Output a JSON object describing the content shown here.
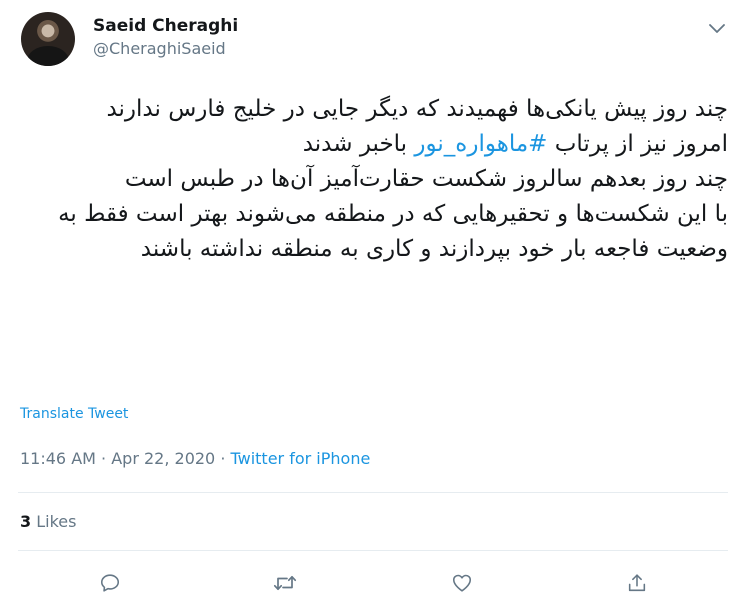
{
  "author": {
    "display_name": "Saeid Cheraghi",
    "handle": "@CheraghiSaeid"
  },
  "tweet": {
    "line1": "چند روز پیش یانکی‌ها فهمیدند که دیگر جایی در خلیج فارس ندارند",
    "line2_before": "امروز نیز از پرتاب ",
    "line2_hashtag": "#ماهواره_نور",
    "line2_after": " باخبر شدند",
    "line3": "چند روز بعدهم سالروز شکست حقارت‌آمیز آن‌ها در طبس است",
    "line4": "با این شکست‌ها و تحقیرهایی که در منطقه می‌شوند بهتر است فقط به وضعیت فاجعه بار خود بپردازند و کاری به منطقه نداشته باشند"
  },
  "translate_label": "Translate Tweet",
  "meta": {
    "time": "11:46 AM",
    "separator": " · ",
    "date": "Apr 22, 2020",
    "source": "Twitter for iPhone"
  },
  "stats": {
    "likes_count": "3",
    "likes_label": "Likes"
  },
  "colors": {
    "link": "#1b95e0",
    "muted": "#657786",
    "text": "#14171a",
    "divider": "#e6ecf0"
  },
  "icons": {
    "menu": "chevron-down-icon",
    "reply": "reply-icon",
    "retweet": "retweet-icon",
    "like": "heart-icon",
    "share": "share-icon"
  }
}
